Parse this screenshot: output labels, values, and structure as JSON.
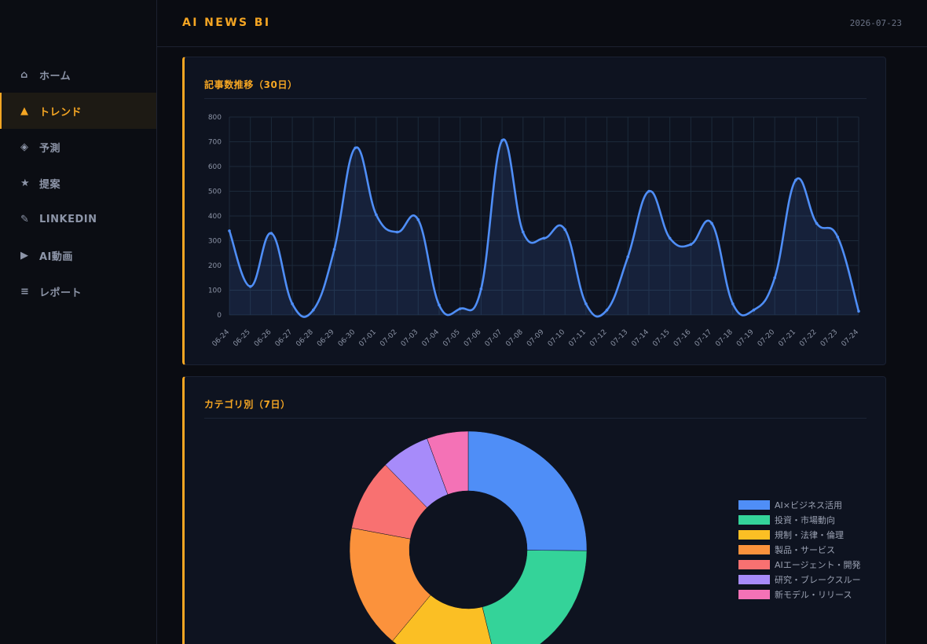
{
  "header": {
    "title": "AI NEWS BI",
    "date": "2026-07-23"
  },
  "sidebar": {
    "items": [
      {
        "label": "ホーム",
        "icon": "home-icon",
        "glyph": "⌂",
        "active": false
      },
      {
        "label": "トレンド",
        "icon": "trend-icon",
        "glyph": "▲",
        "active": true
      },
      {
        "label": "予測",
        "icon": "diamond-icon",
        "glyph": "◈",
        "active": false
      },
      {
        "label": "提案",
        "icon": "star-icon",
        "glyph": "★",
        "active": false
      },
      {
        "label": "LINKEDIN",
        "icon": "pencil-icon",
        "glyph": "✎",
        "active": false
      },
      {
        "label": "AI動画",
        "icon": "play-icon",
        "glyph": "▶",
        "active": false
      },
      {
        "label": "レポート",
        "icon": "list-icon",
        "glyph": "≡",
        "active": false
      }
    ]
  },
  "cards": {
    "trend_title": "記事数推移（30日）",
    "category_title": "カテゴリ別（7日）"
  },
  "colors": {
    "accent": "#f5a623",
    "line": "#4f8ef7",
    "bg": "#0a0c12",
    "card": "#0e1320"
  },
  "chart_data": [
    {
      "type": "area",
      "title": "記事数推移（30日）",
      "x": [
        "06-24",
        "06-25",
        "06-26",
        "06-27",
        "06-28",
        "06-29",
        "06-30",
        "07-01",
        "07-02",
        "07-03",
        "07-04",
        "07-05",
        "07-06",
        "07-07",
        "07-08",
        "07-09",
        "07-10",
        "07-11",
        "07-12",
        "07-13",
        "07-14",
        "07-15",
        "07-16",
        "07-17",
        "07-18",
        "07-19",
        "07-20",
        "07-21",
        "07-22",
        "07-23",
        "07-24"
      ],
      "series": [
        {
          "values": [
            340,
            115,
            330,
            45,
            20,
            265,
            675,
            405,
            335,
            385,
            40,
            25,
            105,
            705,
            335,
            310,
            345,
            45,
            20,
            235,
            500,
            310,
            285,
            370,
            45,
            20,
            150,
            545,
            370,
            315,
            15
          ]
        }
      ],
      "ylim": [
        0,
        800
      ],
      "yticks": [
        0,
        100,
        200,
        300,
        400,
        500,
        600,
        700,
        800
      ],
      "grid": true
    },
    {
      "type": "pie",
      "title": "カテゴリ別（7日）",
      "donut": true,
      "categories": [
        "AI×ビジネス活用",
        "投資・市場動向",
        "規制・法律・倫理",
        "製品・サービス",
        "AIエージェント・開発",
        "研究・ブレークスルー",
        "新モデル・リリース"
      ],
      "values": [
        24.5,
        20.5,
        14.5,
        16.5,
        9.5,
        6.5,
        5.5
      ],
      "colors": [
        "#4f8ef7",
        "#34d399",
        "#fbbf24",
        "#fb923c",
        "#f87171",
        "#a78bfa",
        "#f472b6"
      ],
      "legend": "right"
    }
  ]
}
